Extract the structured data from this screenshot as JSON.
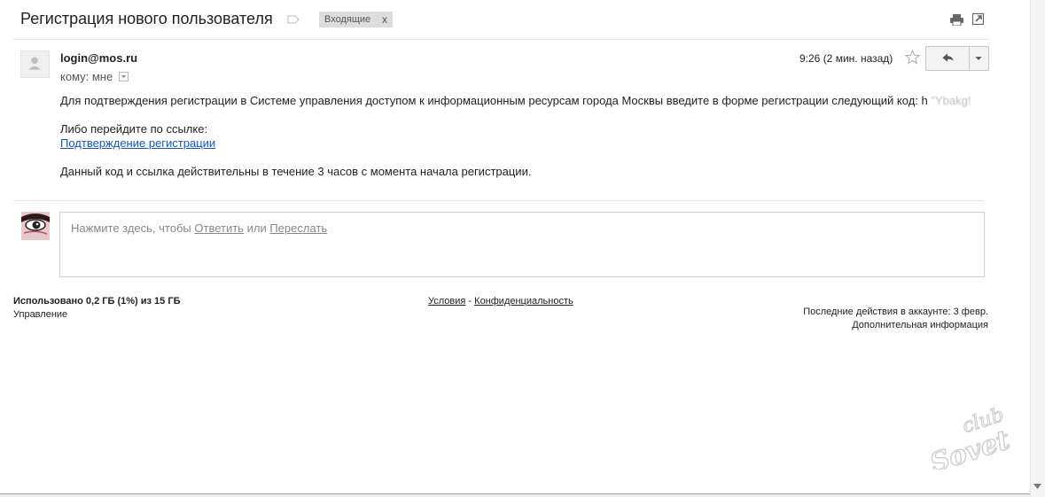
{
  "header": {
    "subject": "Регистрация нового пользователя",
    "label_chip": "Входящие",
    "label_chip_remove": "x",
    "icons": [
      "label-icon",
      "print-icon",
      "new-window-icon"
    ]
  },
  "message": {
    "sender": "login@mos.ru",
    "to_line": "кому: мне",
    "timestamp": "9:26 (2 мин. назад)",
    "body": {
      "line1": "Для подтверждения регистрации в Системе управления доступом к информационным ресурсам города Москвы введите в форме регистрации следующий код: h",
      "code_obscured": "\"Ybakg!",
      "line2": "Либо перейдите по ссылке:",
      "link": "Подтверждение регистрации",
      "line3": "Данный код и ссылка действительны в течение 3 часов с момента начала регистрации."
    },
    "icons": [
      "avatar-placeholder-icon",
      "star-icon",
      "reply-icon",
      "dropdown-arrow-icon"
    ]
  },
  "reply_box": {
    "prefix": "Нажмите здесь, чтобы",
    "reply": "Ответить",
    "or": "или",
    "forward": "Переслать"
  },
  "footer": {
    "storage": "Использовано 0,2 ГБ (1%) из 15 ГБ",
    "manage": "Управление",
    "terms": "Условия",
    "separator": "-",
    "privacy": "Конфиденциальность",
    "last_activity": "Последние действия в аккаунте: 3 февр.",
    "details": "Дополнительная информация"
  },
  "watermark": {
    "text_top": "club",
    "text_bottom": "Sovet"
  },
  "colors": {
    "link": "#1155cc",
    "chip_bg": "#dddddd",
    "divider": "#e5e5e5"
  }
}
